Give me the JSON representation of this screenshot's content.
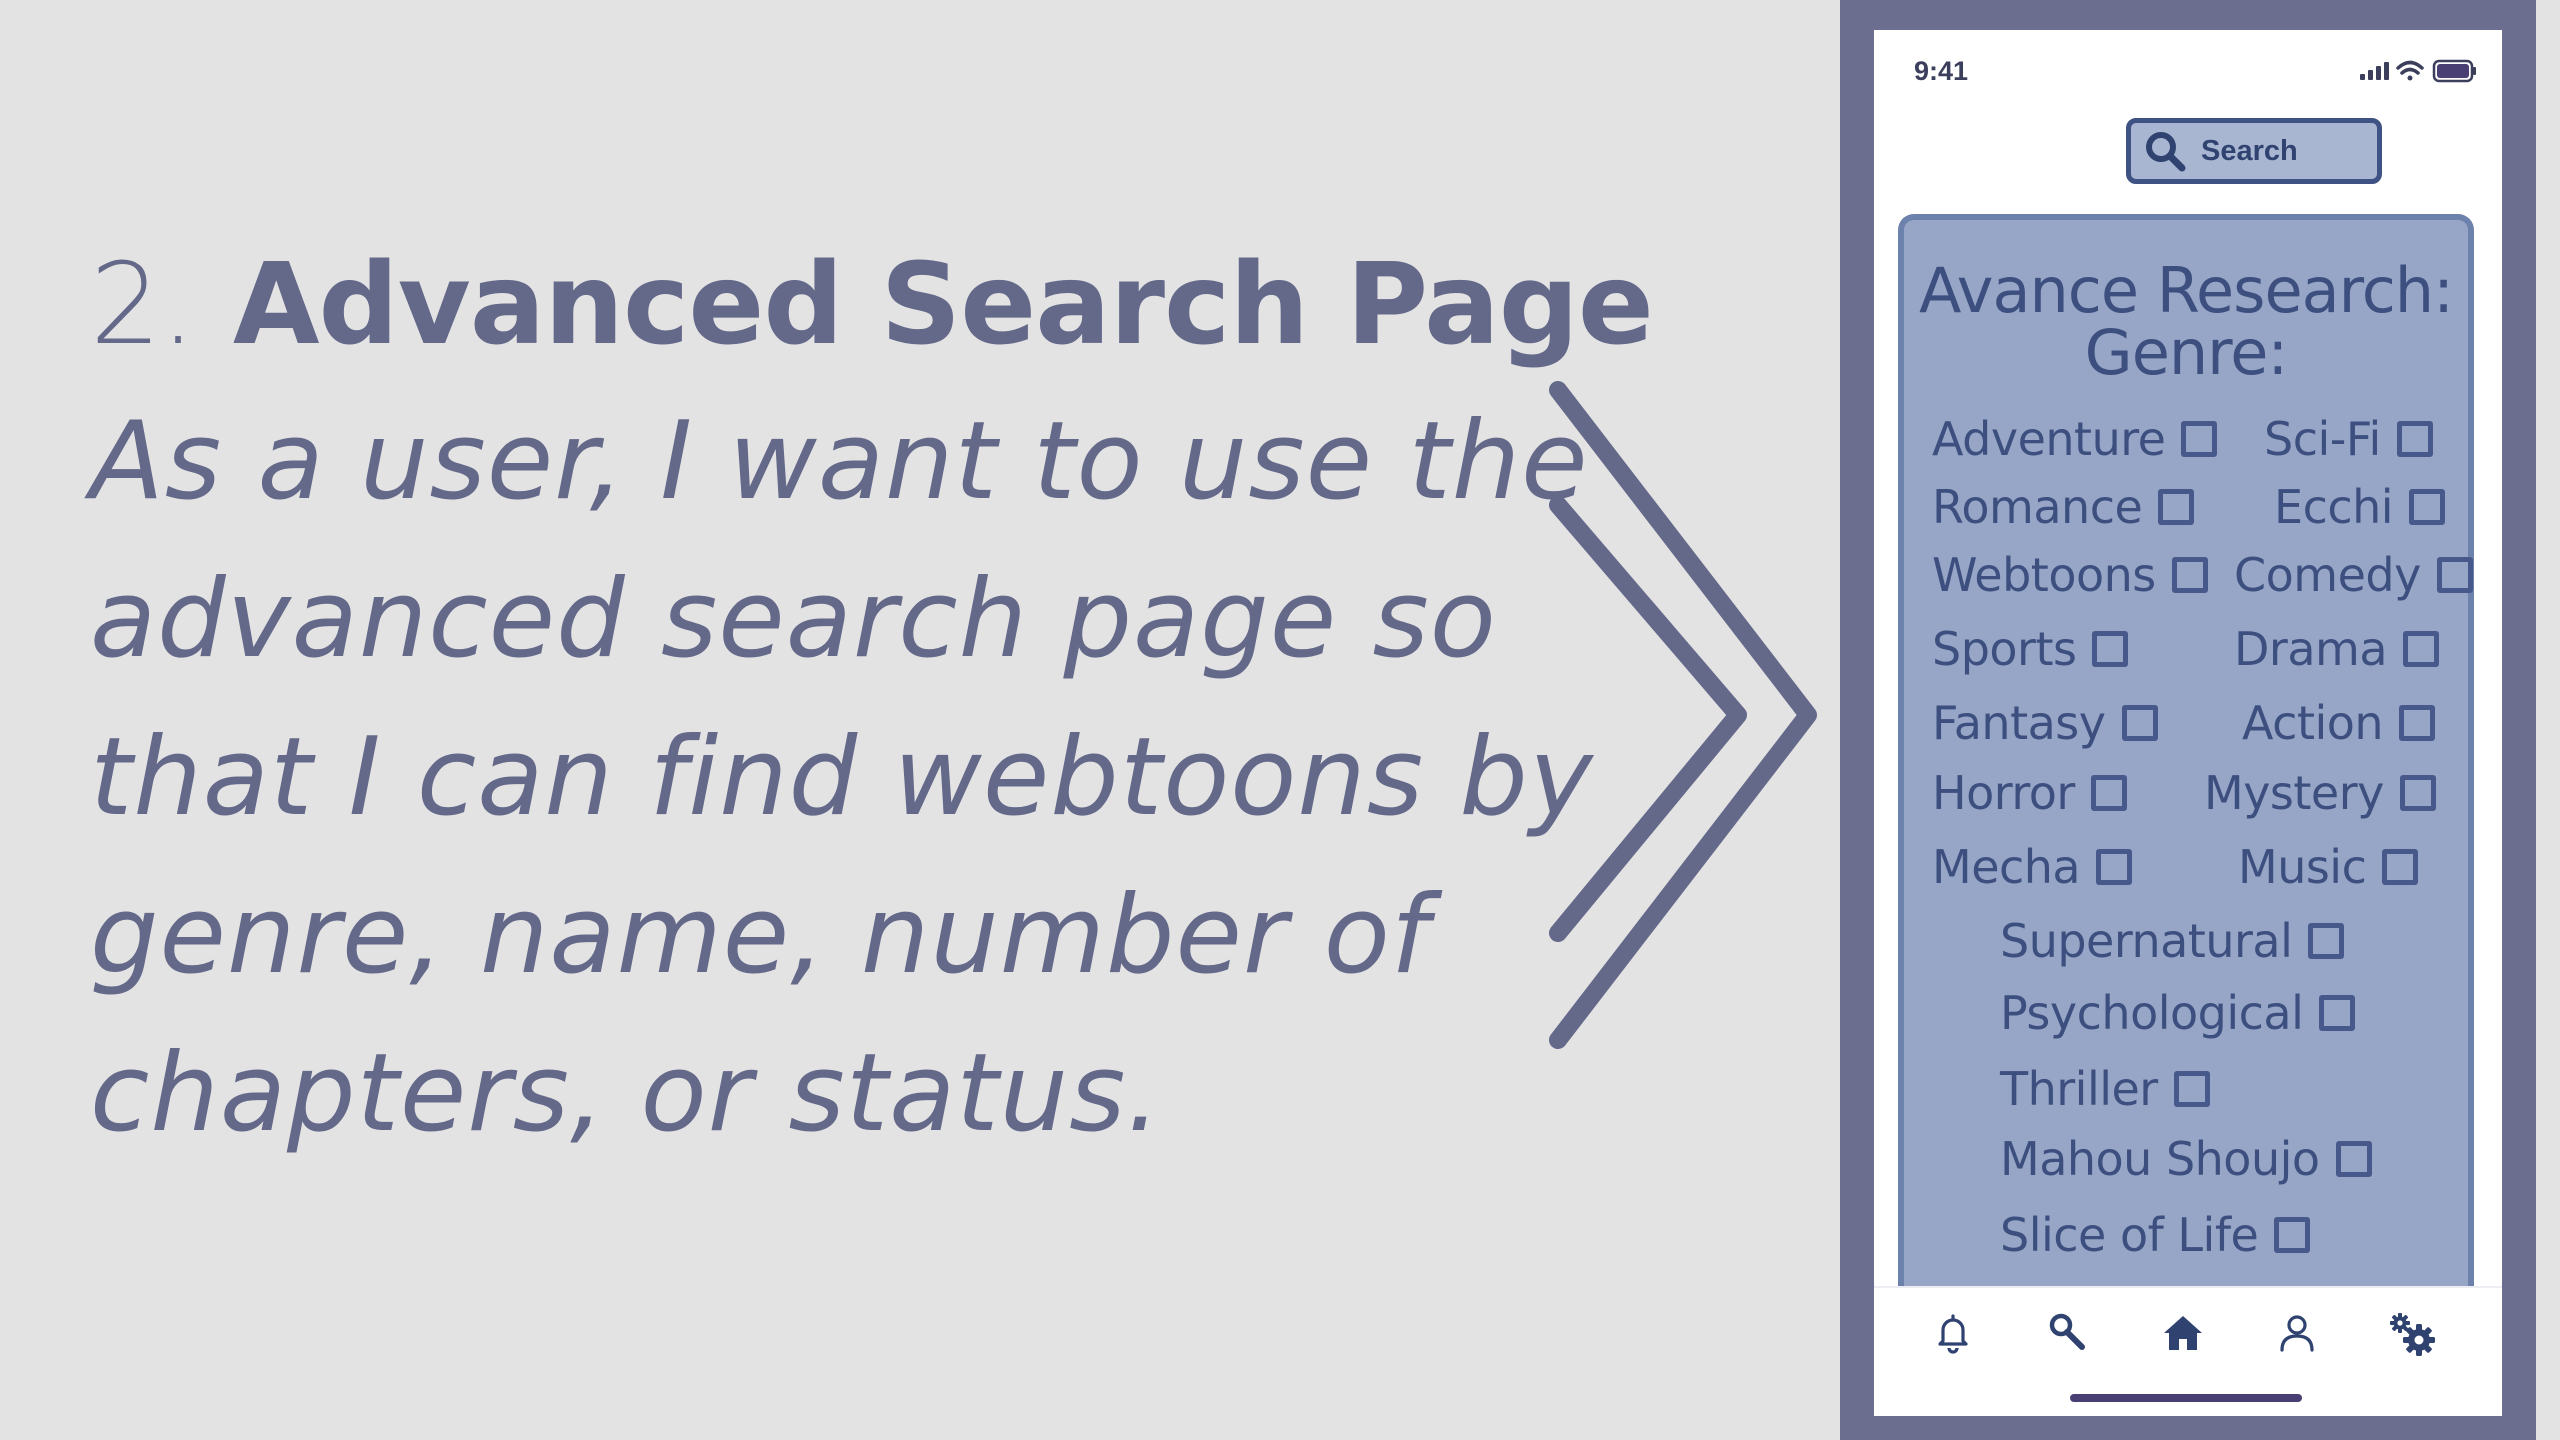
{
  "slide": {
    "title_number": "2.",
    "title_bold": "Advanced Search Page",
    "story_lines": [
      "As a user, I want to use the",
      "advanced search page so",
      "that I can find webtoons by",
      "genre, name, number of",
      "chapters, or status."
    ]
  },
  "phone": {
    "status_time": "9:41",
    "search_button_label": "Search",
    "panel_title_line1": "Avance Research:",
    "panel_title_line2": "Genre:",
    "genres": {
      "adventure": "Adventure",
      "scifi": "Sci-Fi",
      "romance": "Romance",
      "ecchi": "Ecchi",
      "webtoons": "Webtoons",
      "comedy": "Comedy",
      "sports": "Sports",
      "drama": "Drama",
      "fantasy": "Fantasy",
      "action": "Action",
      "horror": "Horror",
      "mystery": "Mystery",
      "mecha": "Mecha",
      "music": "Music",
      "supernatural": "Supernatural",
      "psychological": "Psychological",
      "thriller": "Thriller",
      "mahou_shoujo": "Mahou Shoujo",
      "slice_of_life": "Slice of Life"
    },
    "nav_icons": [
      "bell-icon",
      "search-icon",
      "home-icon",
      "user-icon",
      "gear-icon"
    ]
  },
  "colors": {
    "background": "#e3e3e3",
    "slide_text": "#646889",
    "phone_frame": "#6b6e8f",
    "panel": "#97a5c7",
    "panel_text": "#3c4f7e",
    "search_button": "#a9b6d2"
  }
}
